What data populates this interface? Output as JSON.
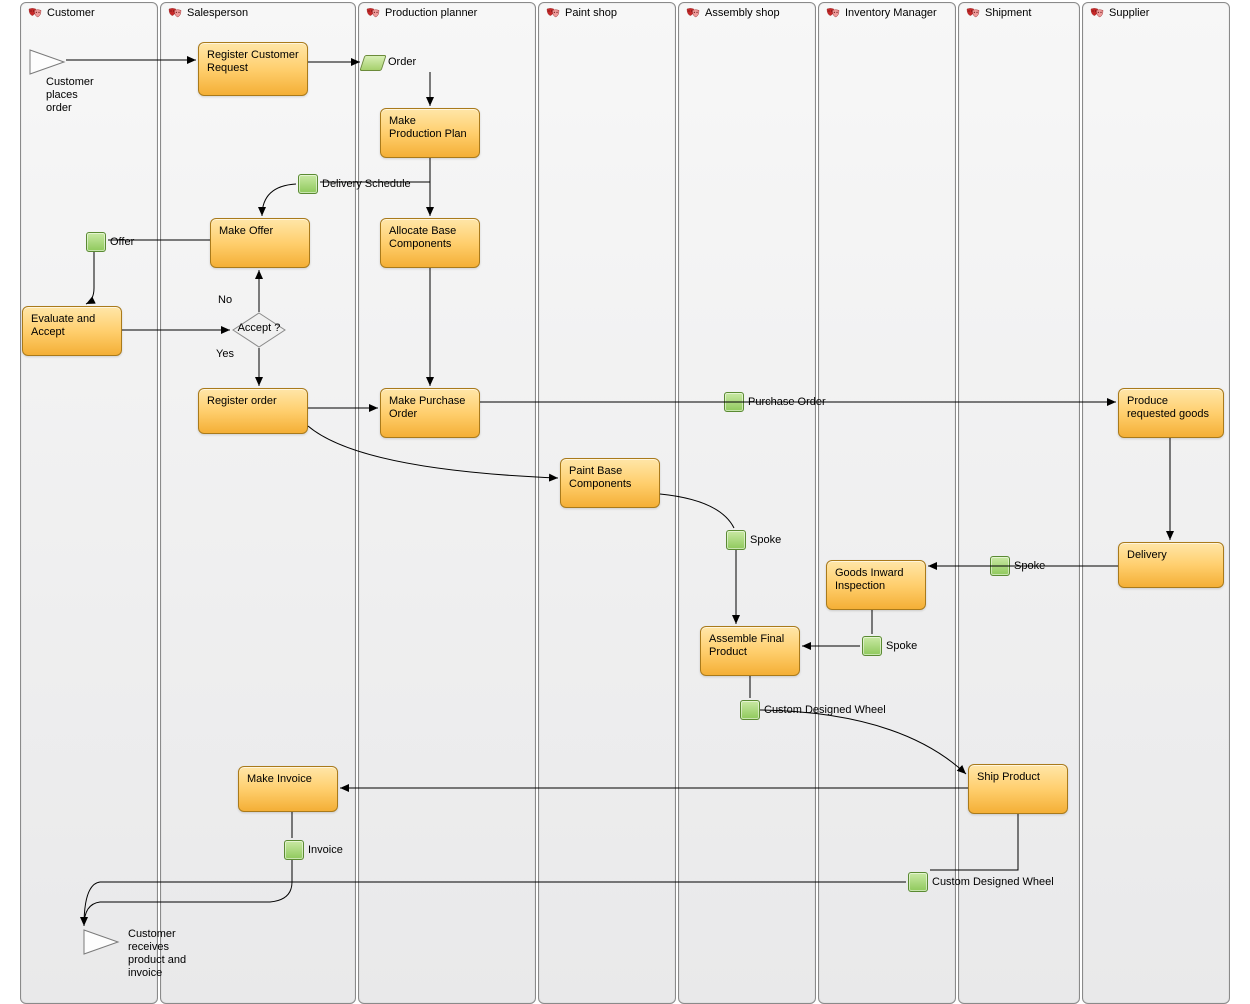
{
  "lanes": [
    {
      "id": "customer",
      "title": "Customer"
    },
    {
      "id": "salesperson",
      "title": "Salesperson"
    },
    {
      "id": "production",
      "title": "Production planner"
    },
    {
      "id": "paint",
      "title": "Paint shop"
    },
    {
      "id": "assembly",
      "title": "Assembly shop"
    },
    {
      "id": "inventory",
      "title": "Inventory Manager"
    },
    {
      "id": "shipment",
      "title": "Shipment"
    },
    {
      "id": "supplier",
      "title": "Supplier"
    }
  ],
  "events": {
    "start": "Customer places order",
    "end": "Customer receives product and invoice"
  },
  "decision": {
    "label": "Accept ?",
    "yes": "Yes",
    "no": "No"
  },
  "objects": {
    "order": "Order",
    "deliverySchedule": "Delivery Schedule",
    "offer": "Offer",
    "purchaseOrder": "Purchase Order",
    "spoke1": "Spoke",
    "spoke2": "Spoke",
    "spoke3": "Spoke",
    "customWheel1": "Custom Designed Wheel",
    "customWheel2": "Custom Designed Wheel",
    "invoice": "Invoice"
  },
  "tasks": {
    "registerCustomerRequest": "Register Customer Request",
    "makeProductionPlan": "Make Production Plan",
    "allocateBase": "Allocate Base Components",
    "makeOffer": "Make Offer",
    "evaluateAccept": "Evaluate and Accept",
    "registerOrder": "Register order",
    "makePurchaseOrder": "Make Purchase Order",
    "paintBase": "Paint Base Components",
    "produceGoods": "Produce requested goods",
    "delivery": "Delivery",
    "goodsInward": "Goods Inward Inspection",
    "assembleFinal": "Assemble Final Product",
    "shipProduct": "Ship Product",
    "makeInvoice": "Make Invoice"
  }
}
